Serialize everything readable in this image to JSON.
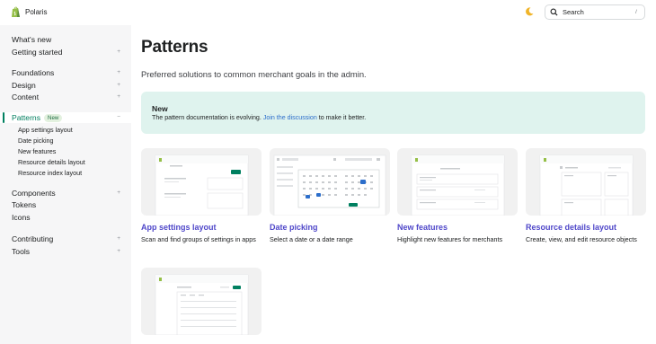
{
  "header": {
    "brand_name": "Polaris",
    "search_label": "Search",
    "search_shortcut": "/"
  },
  "sidebar": {
    "items": [
      {
        "label": "What's new",
        "expandable": false
      },
      {
        "label": "Getting started",
        "expandable": true
      },
      {
        "label": "Foundations",
        "expandable": true
      },
      {
        "label": "Design",
        "expandable": true
      },
      {
        "label": "Content",
        "expandable": true
      },
      {
        "label": "Patterns",
        "expandable": true,
        "active": true,
        "badge": "New"
      },
      {
        "label": "Components",
        "expandable": true
      },
      {
        "label": "Tokens",
        "expandable": false
      },
      {
        "label": "Icons",
        "expandable": false
      },
      {
        "label": "Contributing",
        "expandable": true
      },
      {
        "label": "Tools",
        "expandable": true
      }
    ],
    "plus_symbol": "+",
    "minus_symbol": "−",
    "patterns_children": [
      "App settings layout",
      "Date picking",
      "New features",
      "Resource details layout",
      "Resource index layout"
    ]
  },
  "main": {
    "title": "Patterns",
    "description": "Preferred solutions to common merchant goals in the admin.",
    "banner": {
      "title": "New",
      "text_before": "The pattern documentation is evolving. ",
      "link_text": "Join the discussion",
      "text_after": " to make it better."
    },
    "cards": [
      {
        "title": "App settings layout",
        "description": "Scan and find groups of settings in apps"
      },
      {
        "title": "Date picking",
        "description": "Select a date or a date range"
      },
      {
        "title": "New features",
        "description": "Highlight new features for merchants"
      },
      {
        "title": "Resource details layout",
        "description": "Create, view, and edit resource objects"
      },
      {
        "title": "",
        "description": ""
      }
    ]
  },
  "colors": {
    "accent": "#008060",
    "link": "#2c6ecb",
    "card_title": "#4f47c9",
    "banner_bg": "#dff3ee",
    "sidebar_bg": "#f6f6f7"
  }
}
